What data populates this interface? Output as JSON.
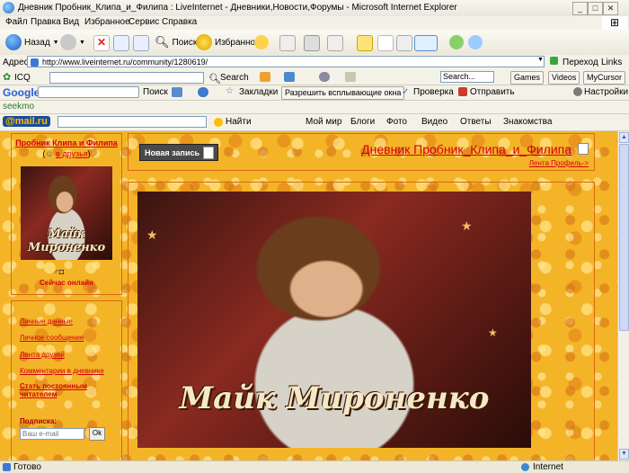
{
  "window": {
    "title": "Дневник Пробник_Клипа_и_Филипа : LiveInternet - Дневники,Новости,Форумы - Microsoft Internet Explorer"
  },
  "menu": [
    "Файл",
    "Правка",
    "Вид",
    "Избранное",
    "Сервис",
    "Справка"
  ],
  "nav": {
    "back": "Назад",
    "search": "Поиск",
    "favorites": "Избранное"
  },
  "address": {
    "label": "Адрес:",
    "url": "http://www.liveinternet.ru/community/1280619/",
    "go": "Переход",
    "links": "Links"
  },
  "icq_bar": {
    "icq": "ICQ",
    "search": "Search",
    "search_field_value": "Search...",
    "games": "Games",
    "videos": "Videos",
    "mycursor": "MyCursor"
  },
  "google_bar": {
    "logo": "Google",
    "search": "Поиск",
    "bookmarks": "Закладки",
    "popups": "Разрешить всплывающие окна",
    "check": "Проверка",
    "send": "Отправить",
    "settings": "Настройки"
  },
  "seekmo": "seekmo",
  "mail_bar": {
    "logo": "@mail.ru",
    "find": "Найти",
    "items": [
      "Мой мир",
      "Блоги",
      "Фото",
      "Видео",
      "Ответы",
      "Знакомства"
    ]
  },
  "sidebar": {
    "profile_name": "Пробник Клипа и Филипа",
    "add_friends": "в друзья",
    "avatar_caption": "Майк Мироненко",
    "online_status": "Сейчас онлайн",
    "links": [
      "Личные данные",
      "Личное сообщение",
      "Лента друзей",
      "Комментарии в дневнике",
      "Стать постоянным читателем"
    ],
    "subscribe_label": "Подписка:",
    "email_placeholder": "Ваш e-mail",
    "ok_button": "Ok"
  },
  "main": {
    "new_post_button": "Новая запись",
    "diary_title": "Дневник Пробник_Клипа_и_Филипа",
    "profile_feed_link": "Лента Профиль->",
    "photo_caption": "Майк Мироненко"
  },
  "status": {
    "text": "Готово",
    "zone": "Internet"
  },
  "colors": {
    "accent_red": "#d4000c",
    "page_orange": "#f4b428"
  }
}
